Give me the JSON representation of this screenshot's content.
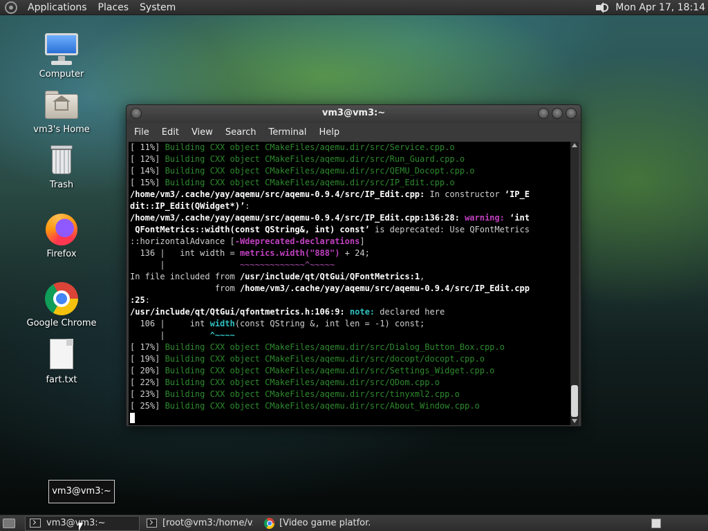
{
  "top_panel": {
    "menus": [
      "Applications",
      "Places",
      "System"
    ],
    "clock": "Mon Apr 17, 18:14"
  },
  "desktop_icons": [
    {
      "label": "Computer",
      "icon": "computer-icon"
    },
    {
      "label": "vm3's Home",
      "icon": "home-folder-icon"
    },
    {
      "label": "Trash",
      "icon": "trash-icon"
    },
    {
      "label": "Firefox",
      "icon": "firefox-icon"
    },
    {
      "label": "Google Chrome",
      "icon": "chrome-icon"
    },
    {
      "label": "fart.txt",
      "icon": "text-file-icon"
    }
  ],
  "terminal": {
    "title": "vm3@vm3:~",
    "menu": [
      "File",
      "Edit",
      "View",
      "Search",
      "Terminal",
      "Help"
    ],
    "lines": [
      [
        {
          "c": "n",
          "t": "[ 11%] "
        },
        {
          "c": "g",
          "t": "Building CXX object CMakeFiles/aqemu.dir/src/Service.cpp.o"
        }
      ],
      [
        {
          "c": "n",
          "t": "[ 12%] "
        },
        {
          "c": "g",
          "t": "Building CXX object CMakeFiles/aqemu.dir/src/Run_Guard.cpp.o"
        }
      ],
      [
        {
          "c": "n",
          "t": "[ 14%] "
        },
        {
          "c": "g",
          "t": "Building CXX object CMakeFiles/aqemu.dir/src/QEMU_Docopt.cpp.o"
        }
      ],
      [
        {
          "c": "n",
          "t": "[ 15%] "
        },
        {
          "c": "g",
          "t": "Building CXX object CMakeFiles/aqemu.dir/src/IP_Edit.cpp.o"
        }
      ],
      [
        {
          "c": "b",
          "t": "/home/vm3/.cache/yay/aqemu/src/aqemu-0.9.4/src/IP_Edit.cpp:"
        },
        {
          "c": "n",
          "t": " In constructor "
        },
        {
          "c": "b",
          "t": "‘IP_E"
        }
      ],
      [
        {
          "c": "b",
          "t": "dit::IP_Edit(QWidget*)’"
        },
        {
          "c": "n",
          "t": ":"
        }
      ],
      [
        {
          "c": "b",
          "t": "/home/vm3/.cache/yay/aqemu/src/aqemu-0.9.4/src/IP_Edit.cpp:136:28:"
        },
        {
          "c": "n",
          "t": " "
        },
        {
          "c": "m",
          "t": "warning:"
        },
        {
          "c": "n",
          "t": " "
        },
        {
          "c": "b",
          "t": "‘int"
        }
      ],
      [
        {
          "c": "b",
          "t": " QFontMetrics::width(const QString&, int) const’"
        },
        {
          "c": "n",
          "t": " is deprecated: Use QFontMetrics"
        }
      ],
      [
        {
          "c": "n",
          "t": "::horizontalAdvance ["
        },
        {
          "c": "m",
          "t": "-Wdeprecated-declarations"
        },
        {
          "c": "n",
          "t": "]"
        }
      ],
      [
        {
          "c": "n",
          "t": "  136 |   int width = "
        },
        {
          "c": "m",
          "t": "metrics.width(\"888\")"
        },
        {
          "c": "n",
          "t": " + 24;"
        }
      ],
      [
        {
          "c": "n",
          "t": "      |               "
        },
        {
          "c": "mn",
          "t": "~~~~~~~~~~~~~^~~~~~"
        }
      ],
      [
        {
          "c": "n",
          "t": "In file included from "
        },
        {
          "c": "b",
          "t": "/usr/include/qt/QtGui/QFontMetrics:1"
        },
        {
          "c": "n",
          "t": ","
        }
      ],
      [
        {
          "c": "n",
          "t": "                 from "
        },
        {
          "c": "b",
          "t": "/home/vm3/.cache/yay/aqemu/src/aqemu-0.9.4/src/IP_Edit.cpp"
        }
      ],
      [
        {
          "c": "b",
          "t": ":25"
        },
        {
          "c": "n",
          "t": ":"
        }
      ],
      [
        {
          "c": "b",
          "t": "/usr/include/qt/QtGui/qfontmetrics.h:106:9:"
        },
        {
          "c": "n",
          "t": " "
        },
        {
          "c": "c",
          "t": "note:"
        },
        {
          "c": "n",
          "t": " declared here"
        }
      ],
      [
        {
          "c": "n",
          "t": "  106 |     int "
        },
        {
          "c": "c",
          "t": "width"
        },
        {
          "c": "n",
          "t": "(const QString &, int len = -1) const;"
        }
      ],
      [
        {
          "c": "n",
          "t": "      |         "
        },
        {
          "c": "c",
          "t": "^~~~~"
        }
      ],
      [
        {
          "c": "n",
          "t": "[ 17%] "
        },
        {
          "c": "g",
          "t": "Building CXX object CMakeFiles/aqemu.dir/src/Dialog_Button_Box.cpp.o"
        }
      ],
      [
        {
          "c": "n",
          "t": "[ 19%] "
        },
        {
          "c": "g",
          "t": "Building CXX object CMakeFiles/aqemu.dir/src/docopt/docopt.cpp.o"
        }
      ],
      [
        {
          "c": "n",
          "t": "[ 20%] "
        },
        {
          "c": "g",
          "t": "Building CXX object CMakeFiles/aqemu.dir/src/Settings_Widget.cpp.o"
        }
      ],
      [
        {
          "c": "n",
          "t": "[ 22%] "
        },
        {
          "c": "g",
          "t": "Building CXX object CMakeFiles/aqemu.dir/src/QDom.cpp.o"
        }
      ],
      [
        {
          "c": "n",
          "t": "[ 23%] "
        },
        {
          "c": "g",
          "t": "Building CXX object CMakeFiles/aqemu.dir/src/tinyxml2.cpp.o"
        }
      ],
      [
        {
          "c": "n",
          "t": "[ 25%] "
        },
        {
          "c": "g",
          "t": "Building CXX object CMakeFiles/aqemu.dir/src/About_Window.cpp.o"
        }
      ]
    ]
  },
  "tooltip": "vm3@vm3:~",
  "taskbar": {
    "tasks": [
      {
        "label": "vm3@vm3:~",
        "icon": "terminal-icon",
        "active": true
      },
      {
        "label": "[root@vm3:/home/v...",
        "icon": "terminal-icon",
        "active": false
      },
      {
        "label": "[Video game platfor...",
        "icon": "chrome-icon",
        "active": false
      }
    ]
  }
}
